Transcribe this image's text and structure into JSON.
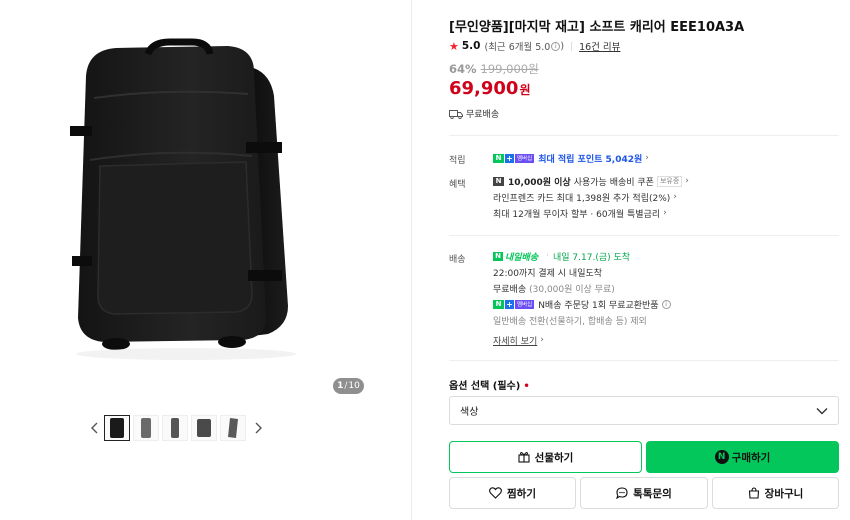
{
  "gallery": {
    "indicator_current": "1",
    "indicator_separator": "/",
    "indicator_total": "10",
    "thumb_count": 5
  },
  "product": {
    "title": "[무인양품][마지막 재고] 소프트 캐리어 EEE10A3A",
    "rating_score": "5.0",
    "rating_recent": "(최근 6개월 5.0",
    "rating_recent_close": ")",
    "review_count": "16건 리뷰",
    "discount_pct": "64%",
    "original_price": "199,000원",
    "price": "69,900",
    "price_unit": "원",
    "shipping_badge": "무료배송"
  },
  "benefits": {
    "point_label": "적립",
    "point_text": "최대 적립 포인트 5,042원",
    "benefit_label": "혜택",
    "coupon_amount": "10,000원 이상",
    "coupon_text": "사용가능 배송비 쿠폰",
    "coupon_badge": "보유중",
    "card_text": "라인프렌즈 카드 최대 1,398원 추가 적립(2%)",
    "installment_text": "최대 12개월 무이자 할부 · 60개월 특별금리"
  },
  "delivery": {
    "label": "배송",
    "logo_text": "내일배송",
    "arrival": "내일 7.17.(금) 도착",
    "deadline": "22:00까지 결제 시 내일도착",
    "free_ship": "무료배송",
    "free_ship_cond": "(30,000원 이상 무료)",
    "exchange_text": "N배송 주문당 1회 무료교환반품",
    "general_text": "일반배송 전환(선물하기, 합배송 등) 제외",
    "detail_link": "자세히 보기"
  },
  "options": {
    "label": "옵션 선택 (필수)",
    "required_mark": "•",
    "select_value": "색상"
  },
  "buttons": {
    "gift": "선물하기",
    "buy": "구매하기",
    "wish": "찜하기",
    "talk": "톡톡문의",
    "cart": "장바구니"
  },
  "colors": {
    "accent_green": "#03c75a",
    "price_red": "#d0021b",
    "point_blue": "#1c55e6"
  }
}
